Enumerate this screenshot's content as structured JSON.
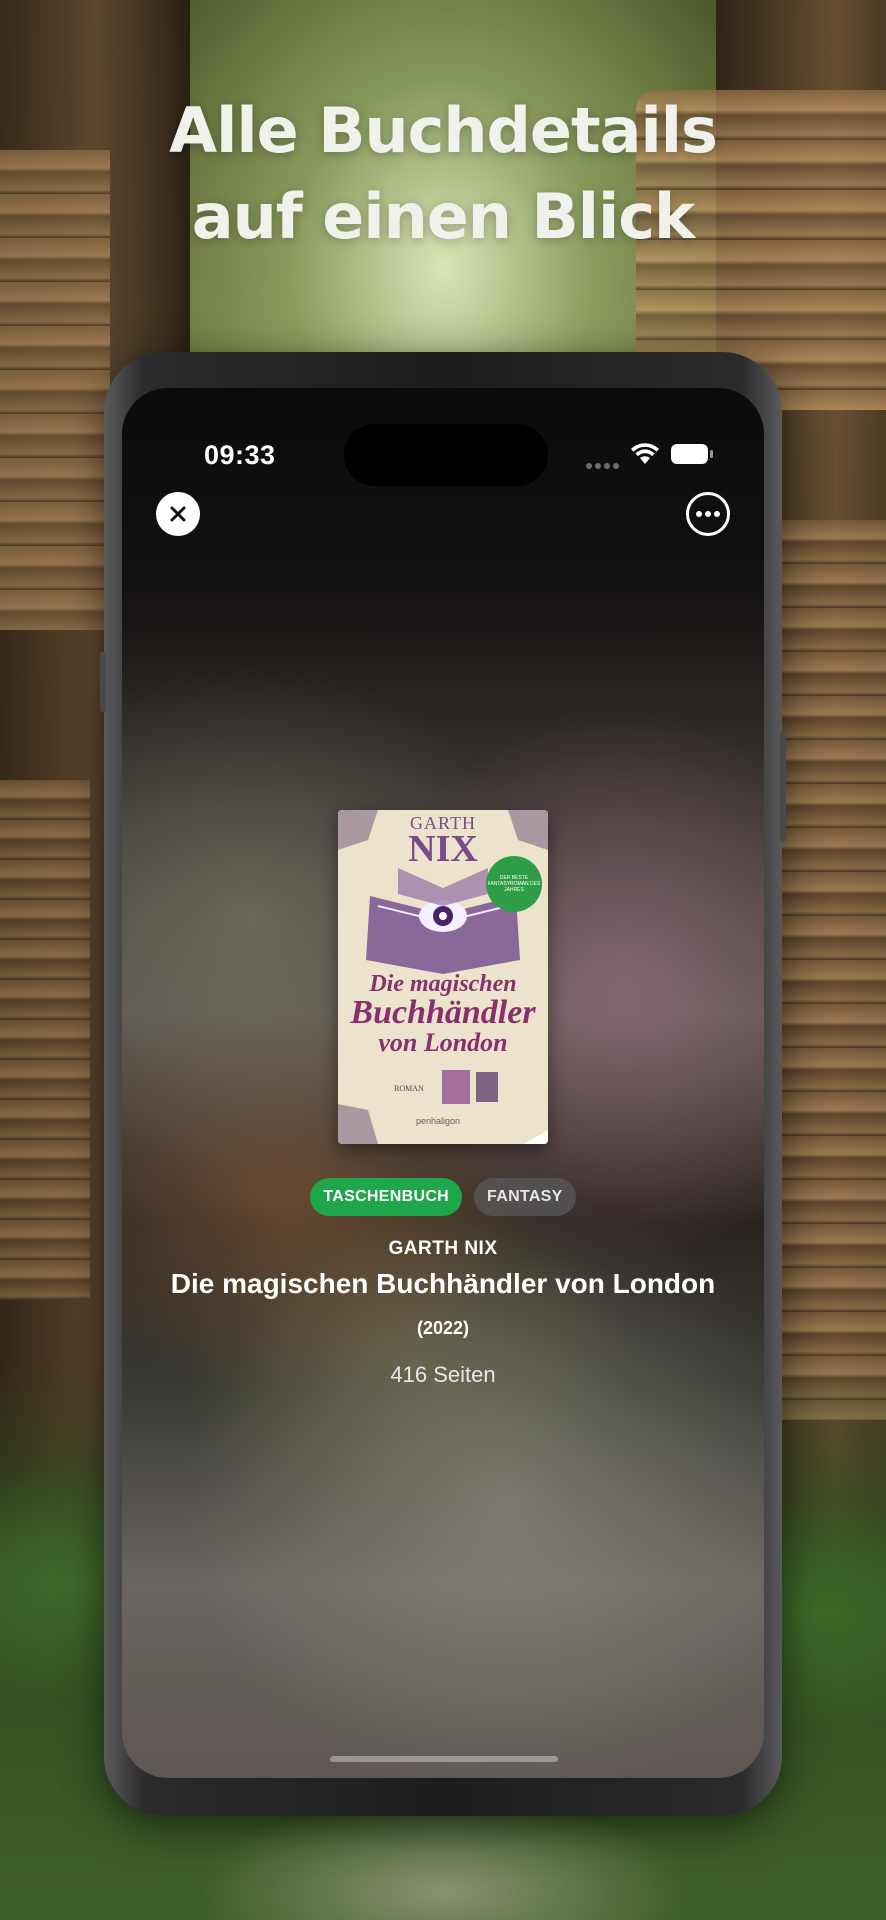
{
  "headline": {
    "line1": "Alle Buchdetails",
    "line2": "auf einen Blick"
  },
  "status_bar": {
    "time": "09:33"
  },
  "toolbar": {
    "close_icon": "close-icon",
    "more_icon": "more-icon"
  },
  "book": {
    "cover": {
      "author_first": "GARTH",
      "author_last": "NIX",
      "title_line1": "Die magischen",
      "title_line2": "Buchhändler",
      "title_line3": "von London",
      "badge": "DER BESTE FANTASYROMAN DES JAHRES",
      "label": "ROMAN",
      "publisher": "penhaligon"
    },
    "format_tag": "TASCHENBUCH",
    "genre_tag": "FANTASY",
    "author": "GARTH NIX",
    "title": "Die magischen Buchhändler von London",
    "year": "(2022)",
    "pages": "416 Seiten"
  },
  "colors": {
    "format_tag_bg": "#1fa64a",
    "genre_tag_bg": "#5a5a5a"
  }
}
